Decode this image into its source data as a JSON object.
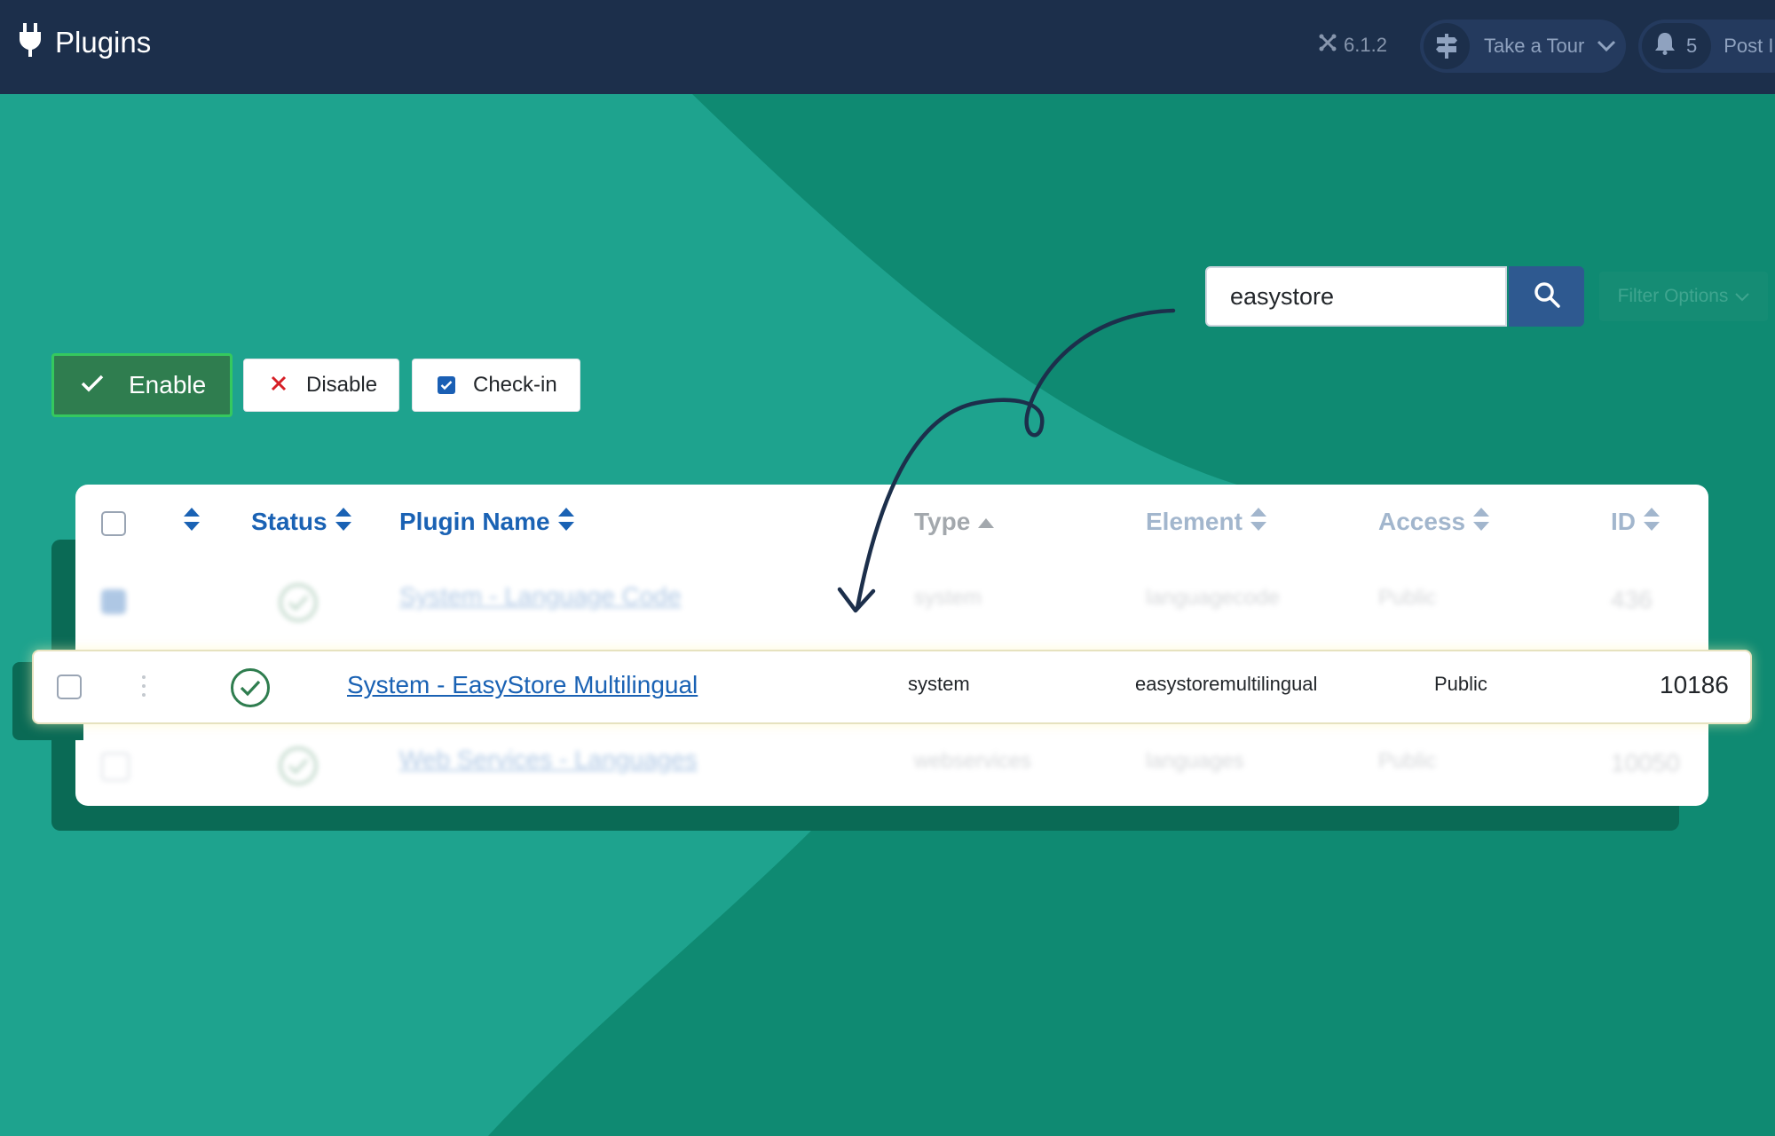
{
  "header": {
    "title": "Plugins",
    "version": "6.1.2",
    "tour_label": "Take a Tour",
    "notification_count": "5",
    "post_label": "Post In"
  },
  "search": {
    "value": "easystore",
    "filter_label": "Filter Options"
  },
  "toolbar": {
    "enable_label": "Enable",
    "disable_label": "Disable",
    "checkin_label": "Check-in"
  },
  "table": {
    "headers": {
      "status": "Status",
      "plugin_name": "Plugin Name",
      "type": "Type",
      "element": "Element",
      "access": "Access",
      "id": "ID"
    },
    "rows": [
      {
        "name": "System - Language Code",
        "type": "system",
        "element": "languagecode",
        "access": "Public",
        "id": "436"
      },
      {
        "name": "System - EasyStore Multilingual",
        "type": "system",
        "element": "easystoremultilingual",
        "access": "Public",
        "id": "10186"
      },
      {
        "name": "Web Services - Languages",
        "type": "webservices",
        "element": "languages",
        "access": "Public",
        "id": "10050"
      }
    ]
  },
  "colors": {
    "topbar": "#1c2f4b",
    "background_light": "#1ea38e",
    "background_dark": "#0f8a72",
    "enable_button": "#2f7d4f",
    "link": "#1a62b4",
    "search_button": "#2e5990"
  }
}
